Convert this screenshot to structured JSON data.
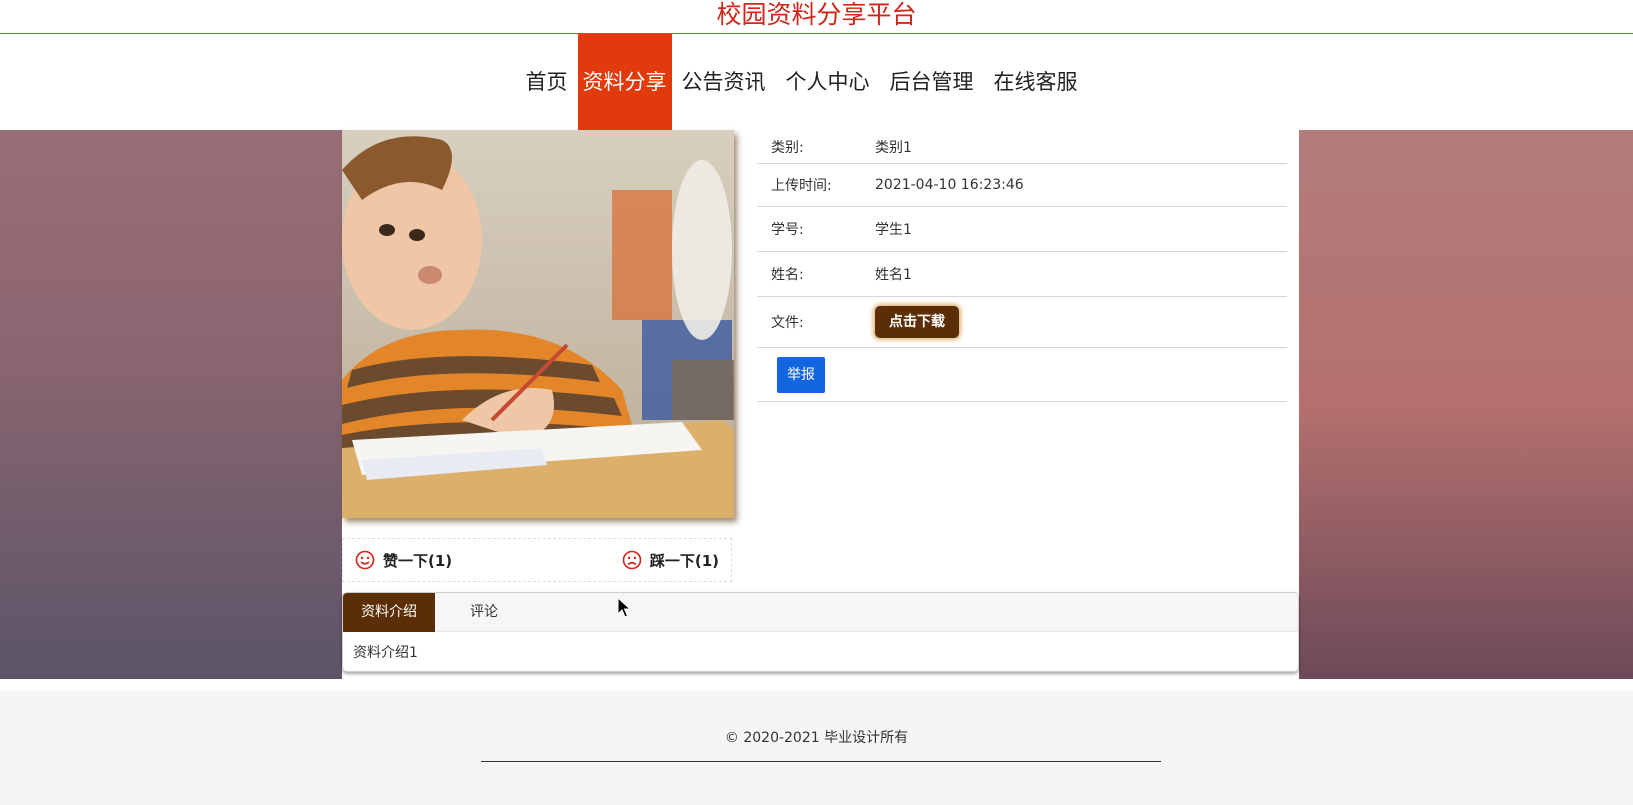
{
  "site": {
    "title": "校园资料分享平台"
  },
  "nav": {
    "items": [
      {
        "label": "首页"
      },
      {
        "label": "资料分享",
        "active": true
      },
      {
        "label": "公告资讯"
      },
      {
        "label": "个人中心"
      },
      {
        "label": "后台管理"
      },
      {
        "label": "在线客服"
      }
    ]
  },
  "info": {
    "category_label": "类别:",
    "category_value": "类别1",
    "upload_time_label": "上传时间:",
    "upload_time_value": "2021-04-10 16:23:46",
    "student_id_label": "学号:",
    "student_id_value": "学生1",
    "name_label": "姓名:",
    "name_value": "姓名1",
    "file_label": "文件:",
    "download_label": "点击下载",
    "report_label": "举报"
  },
  "votes": {
    "like_label": "赞一下(1)",
    "dislike_label": "踩一下(1)"
  },
  "tabs": {
    "items": [
      {
        "label": "资料介绍",
        "active": true
      },
      {
        "label": "评论"
      }
    ],
    "content": "资料介绍1"
  },
  "footer": {
    "copyright": "© 2020-2021 毕业设计所有"
  },
  "colors": {
    "brand_red": "#e03a0d",
    "title_red": "#d0261a",
    "brown": "#5b2e05",
    "report_blue": "#1266e0"
  },
  "icons": {
    "like": "smile-icon",
    "dislike": "frown-icon"
  }
}
